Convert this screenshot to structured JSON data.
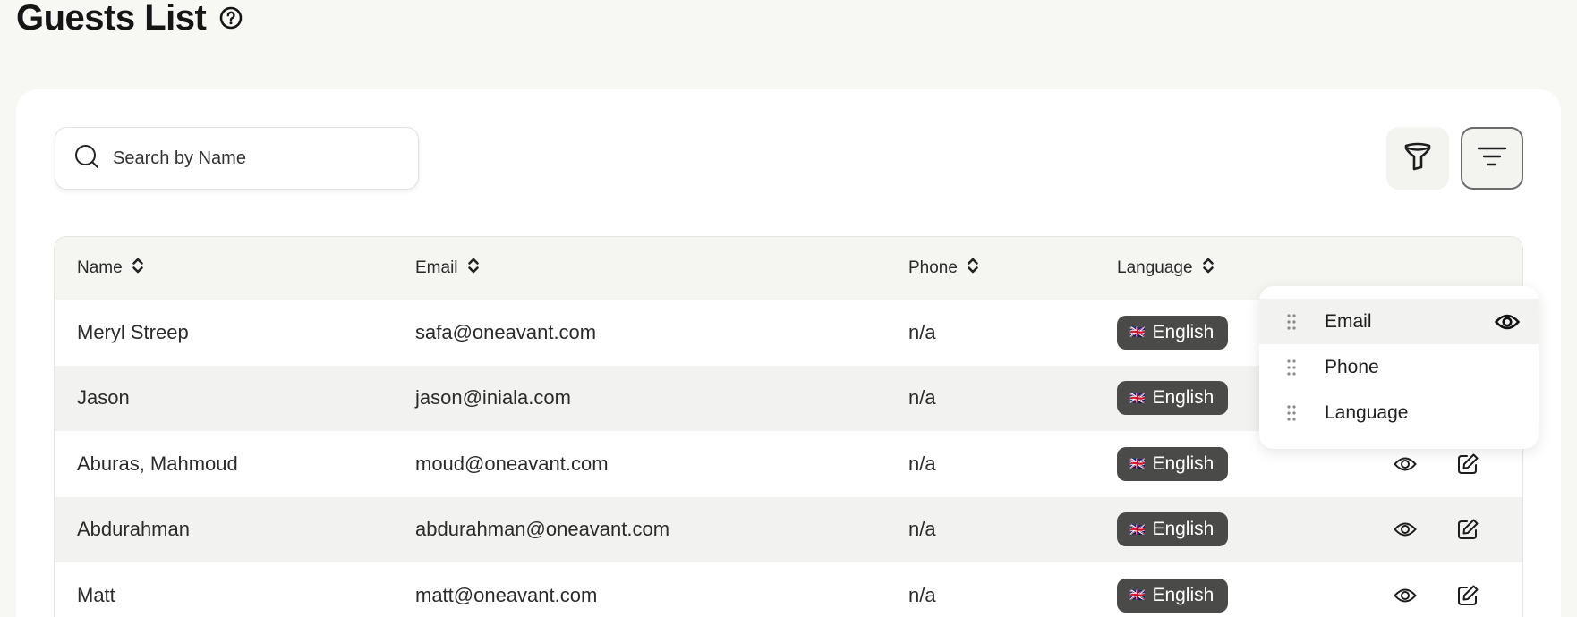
{
  "header": {
    "title": "Guests List"
  },
  "search": {
    "placeholder": "Search by Name",
    "value": ""
  },
  "table": {
    "columns": [
      "Name",
      "Email",
      "Phone",
      "Language"
    ],
    "rows": [
      {
        "name": "Meryl Streep",
        "email": "safa@oneavant.com",
        "phone": "n/a",
        "language": "English",
        "flag": "🇬🇧"
      },
      {
        "name": "Jason",
        "email": "jason@iniala.com",
        "phone": "n/a",
        "language": "English",
        "flag": "🇬🇧"
      },
      {
        "name": "Aburas, Mahmoud",
        "email": "moud@oneavant.com",
        "phone": "n/a",
        "language": "English",
        "flag": "🇬🇧"
      },
      {
        "name": "Abdurahman",
        "email": "abdurahman@oneavant.com",
        "phone": "n/a",
        "language": "English",
        "flag": "🇬🇧"
      },
      {
        "name": "Matt",
        "email": "matt@oneavant.com",
        "phone": "n/a",
        "language": "English",
        "flag": "🇬🇧"
      }
    ]
  },
  "column_menu": {
    "items": [
      {
        "label": "Email",
        "visible_icon": "eye-icon"
      },
      {
        "label": "Phone"
      },
      {
        "label": "Language"
      }
    ]
  },
  "colors": {
    "background": "#f7f7f4",
    "card": "#ffffff",
    "badge": "#4a4a48",
    "row_alt": "#f2f2f0"
  }
}
